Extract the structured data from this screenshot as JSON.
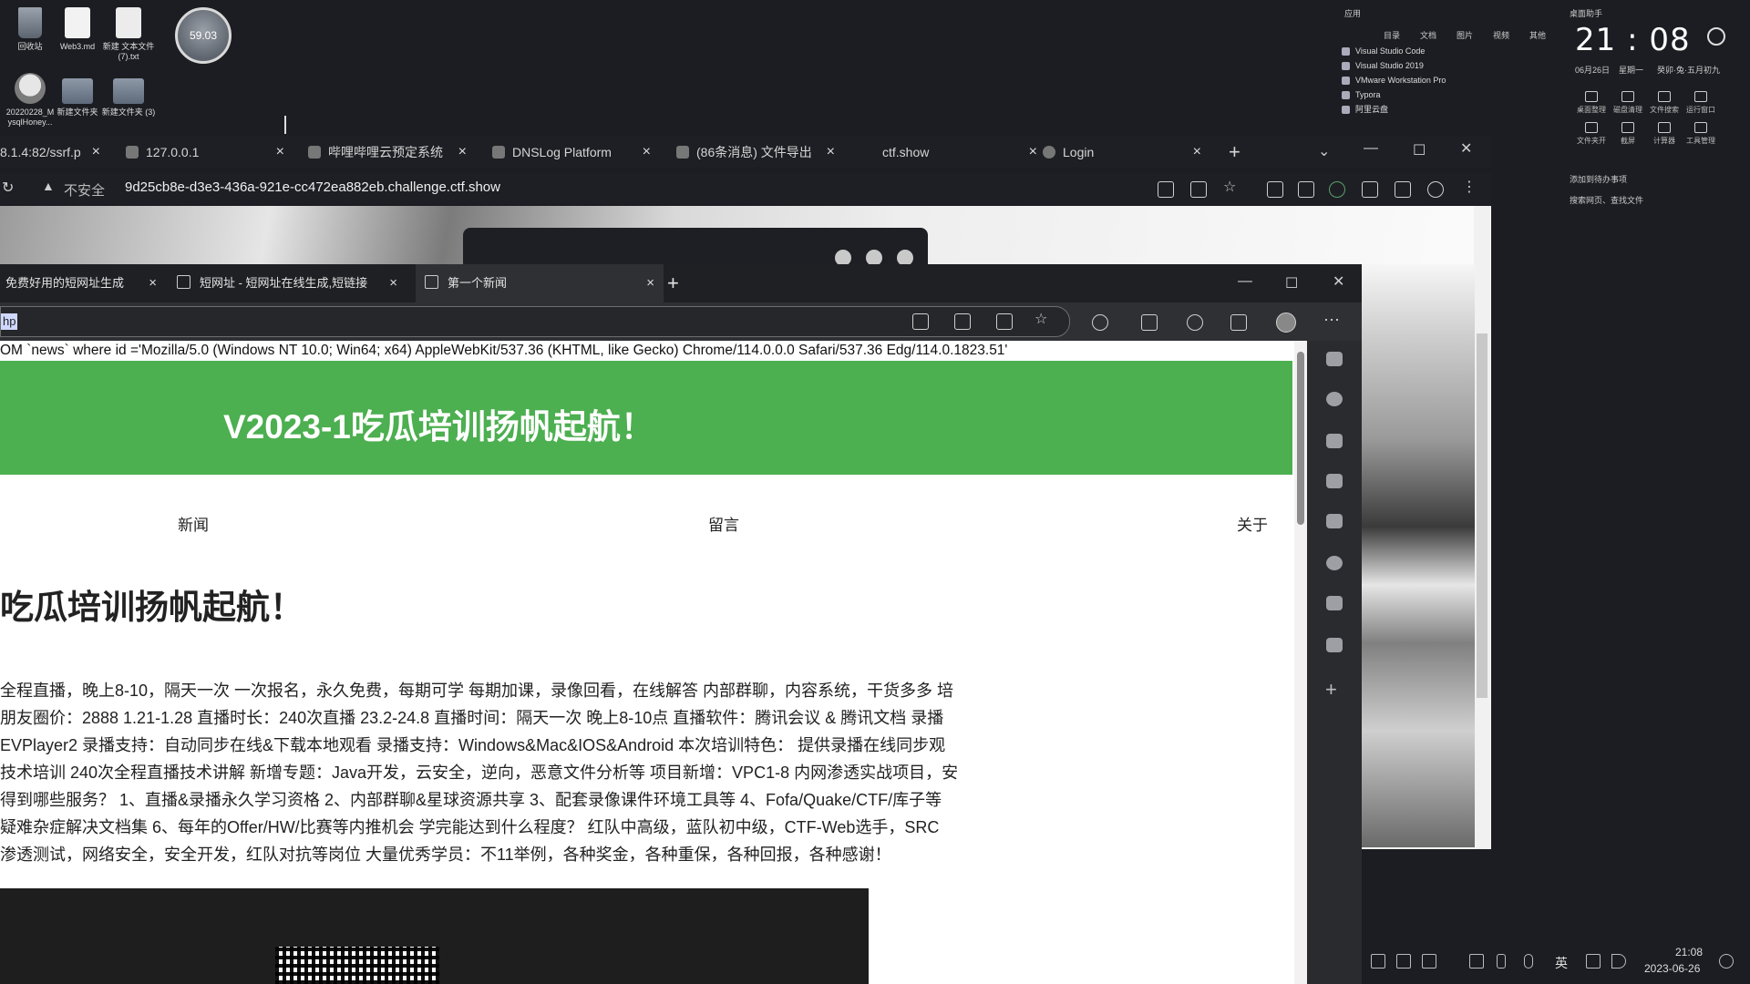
{
  "desktop": {
    "icons": [
      {
        "label": "回收站"
      },
      {
        "label": "Web3.md"
      },
      {
        "label": "新建 文本文件 (7).txt"
      },
      {
        "label": "20220228_M ysqlHoney..."
      },
      {
        "label": "新建文件夹"
      },
      {
        "label": "新建文件夹 (3)"
      }
    ],
    "speed_ball": "59.03"
  },
  "widget": {
    "section_apps": "应用",
    "tabs": [
      "目录",
      "文档",
      "图片",
      "视频",
      "其他"
    ],
    "apps": [
      "Visual Studio Code",
      "Visual Studio 2019",
      "VMware Workstation Pro",
      "Typora",
      "阿里云盘"
    ],
    "desk_assistant": "桌面助手",
    "time": "21 : 08",
    "date": "06月26日",
    "weekday": "星期一",
    "lunar": "癸卯·兔·五月初九",
    "tools": [
      "桌面整理",
      "磁盘清理",
      "文件搜索",
      "运行窗口",
      "文件夹开",
      "截屏",
      "计算器",
      "工具管理"
    ],
    "search_hint": "搜索网页、查找文件",
    "drop_hint": "添加到待办事项"
  },
  "outer_browser": {
    "tabs": [
      {
        "title": "8.1.4:82/ssrf.p"
      },
      {
        "title": "127.0.0.1"
      },
      {
        "title": "哔哩哔哩云预定系统"
      },
      {
        "title": "DNSLog Platform"
      },
      {
        "title": "(86条消息) 文件导出"
      },
      {
        "title": "ctf.show"
      },
      {
        "title": "Login"
      }
    ],
    "new_tab": "+",
    "security": "不安全",
    "url": "9d25cb8e-d3e3-436a-921e-cc472ea882eb.challenge.ctf.show"
  },
  "inner_browser": {
    "tabs": [
      {
        "title": "免费好用的短网址生成"
      },
      {
        "title": "短网址 - 短网址在线生成,短链接"
      },
      {
        "title": "第一个新闻"
      }
    ],
    "new_tab": "+",
    "address_selected": "hp",
    "menu_label": "···"
  },
  "page": {
    "sql_echo": "OM `news` where id ='Mozilla/5.0 (Windows NT 10.0; Win64; x64) AppleWebKit/537.36 (KHTML, like Gecko) Chrome/114.0.0.0 Safari/537.36 Edg/114.0.1823.51'",
    "banner_title": "V2023-1吃瓜培训扬帆起航！",
    "nav": [
      "新闻",
      "留言",
      "关于"
    ],
    "heading": "吃瓜培训扬帆起航！",
    "paragraph": [
      "全程直播，晚上8-10，隔天一次 一次报名，永久免费，每期可学 每期加课，录像回看，在线解答 内部群聊，内容系统，干货多多 培",
      "朋友圈价：2888 1.21-1.28 直播时长：240次直播 23.2-24.8 直播时间：隔天一次 晚上8-10点 直播软件：腾讯会议 & 腾讯文档 录播",
      "EVPlayer2 录播支持：自动同步在线&下载本地观看 录播支持：Windows&Mac&IOS&Android 本次培训特色： 提供录播在线同步观",
      "技术培训 240次全程直播技术讲解 新增专题：Java开发，云安全，逆向，恶意文件分析等 项目新增：VPC1-8 内网渗透实战项目，安",
      "得到哪些服务？ 1、直播&录播永久学习资格 2、内部群聊&星球资源共享 3、配套录像课件环境工具等 4、Fofa/Quake/CTF/库子等",
      "疑难杂症解决文档集 6、每年的Offer/HW/比赛等内推机会 学完能达到什么程度？ 红队中高级，蓝队初中级，CTF-Web选手，SRC",
      "渗透测试，网络安全，安全开发，红队对抗等岗位 大量优秀学员：不11举例，各种奖金，各种重保，各种回报，各种感谢！"
    ]
  },
  "taskbar": {
    "ime": "英",
    "time": "21:08",
    "date": "2023-06-26"
  }
}
